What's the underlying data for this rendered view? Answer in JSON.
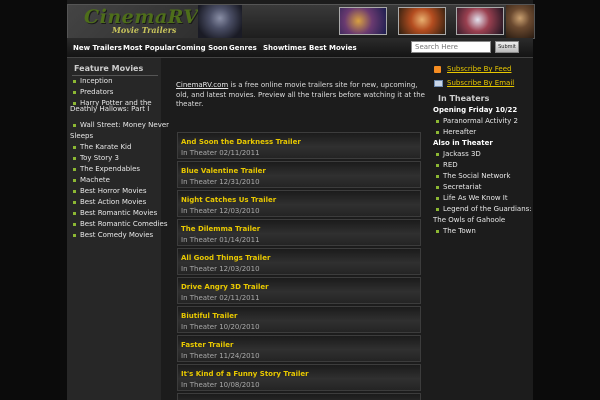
{
  "header": {
    "logo_title": "CinemaRV",
    "logo_subtitle": "Movie Trailers"
  },
  "nav": {
    "items": [
      "New Trailers",
      "Most Popular",
      "Coming Soon",
      "Genres",
      "Showtimes",
      "Best Movies"
    ],
    "search_placeholder": "Search Here",
    "submit_label": "Submit"
  },
  "left_sidebar": {
    "title": "Feature Movies",
    "items": [
      "Inception",
      "Predators",
      "Harry Potter and the",
      "Deathly Hallows: Part I",
      "Wall Street: Money Never",
      "Sleeps",
      "The Karate Kid",
      "Toy Story 3",
      "The Expendables",
      "Machete",
      "Best Horror Movies",
      "Best Action Movies",
      "Best Romantic Movies",
      "Best Romantic Comedies",
      "Best Comedy Movies"
    ]
  },
  "main": {
    "intro_link": "CinemaRV.com",
    "intro_text": " is a free online movie trailers site for new, upcoming, old, and latest movies. Preview all the trailers before watching it at the theater.",
    "trailers": [
      {
        "title": "And Soon the Darkness Trailer",
        "date": "In Theater 02/11/2011"
      },
      {
        "title": "Blue Valentine Trailer",
        "date": "In Theater 12/31/2010"
      },
      {
        "title": "Night Catches Us Trailer",
        "date": "In Theater 12/03/2010"
      },
      {
        "title": "The Dilemma Trailer",
        "date": "In Theater 01/14/2011"
      },
      {
        "title": "All Good Things Trailer",
        "date": "In Theater 12/03/2010"
      },
      {
        "title": "Drive Angry 3D Trailer",
        "date": "In Theater 02/11/2011"
      },
      {
        "title": "Biutiful Trailer",
        "date": "In Theater 10/20/2010"
      },
      {
        "title": "Faster Trailer",
        "date": "In Theater 11/24/2010"
      },
      {
        "title": "It's Kind of a Funny Story Trailer",
        "date": "In Theater 10/08/2010"
      }
    ]
  },
  "right_sidebar": {
    "feed_link": "Subscribe By Feed",
    "email_link": "Subscribe By Email",
    "theaters_title": "In Theaters",
    "opening_header": "Opening Friday 10/22",
    "opening_items": [
      "Paranormal Activity 2",
      "Hereafter"
    ],
    "also_header": "Also in Theater",
    "also_items": [
      "Jackass 3D",
      "RED",
      "The Social Network",
      "Secretariat",
      "Life As We Know It",
      "Legend of the Guardians:",
      "The Owls of Gahoole",
      "The Town"
    ]
  }
}
